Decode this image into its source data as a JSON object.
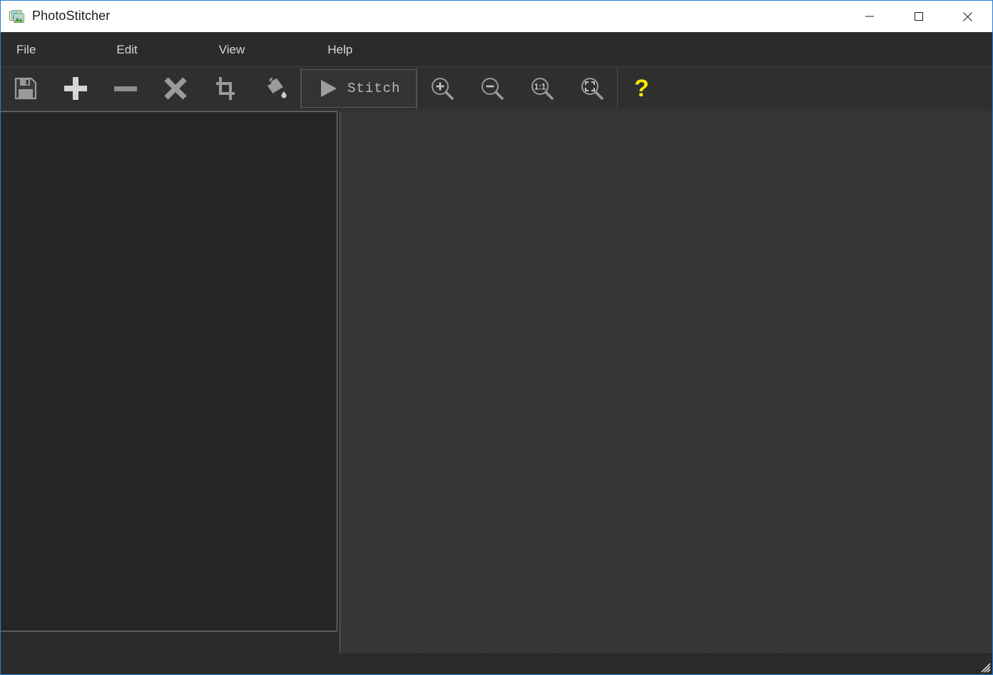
{
  "window": {
    "title": "PhotoStitcher",
    "app_icon": "photo-stack-icon",
    "controls": {
      "minimize_label": "Minimize",
      "maximize_label": "Maximize",
      "close_label": "Close"
    }
  },
  "menu": {
    "items": [
      {
        "label": "File",
        "name": "menu-file"
      },
      {
        "label": "Edit",
        "name": "menu-edit"
      },
      {
        "label": "View",
        "name": "menu-view"
      },
      {
        "label": "Help",
        "name": "menu-help"
      }
    ]
  },
  "toolbar": {
    "save_icon": "floppy-disk-save-icon",
    "add_icon": "plus-add-icon",
    "remove_icon": "minus-remove-icon",
    "clear_icon": "x-clear-icon",
    "crop_icon": "crop-icon",
    "fill_icon": "paint-bucket-fill-icon",
    "stitch_label": "Stitch",
    "stitch_play_icon": "play-triangle-icon",
    "zoom_in_icon": "magnifier-plus-icon",
    "zoom_out_icon": "magnifier-minus-icon",
    "zoom_actual_label": "1:1",
    "zoom_actual_icon": "magnifier-one-to-one-icon",
    "zoom_fit_icon": "magnifier-fit-to-window-icon",
    "help_glyph": "?",
    "help_icon": "question-mark-help-icon"
  },
  "panels": {
    "thumbnail_panel_name": "image-list-panel",
    "thumbnail_panel_items": [],
    "canvas_name": "preview-canvas",
    "canvas_content": ""
  },
  "status_bar": {
    "text": "",
    "resize_grip_icon": "resize-grip-icon"
  },
  "colors": {
    "titlebar_bg": "#ffffff",
    "titlebar_text": "#1b1b1b",
    "window_border": "#2a7fd4",
    "chrome_bg": "#2b2b2b",
    "toolbar_bg": "#2f2f2f",
    "icon_gray": "#9a9a9a",
    "panel_bg": "#262626",
    "canvas_bg": "#343434",
    "help_yellow": "#f7e900",
    "menu_text": "#d8d8d8"
  }
}
